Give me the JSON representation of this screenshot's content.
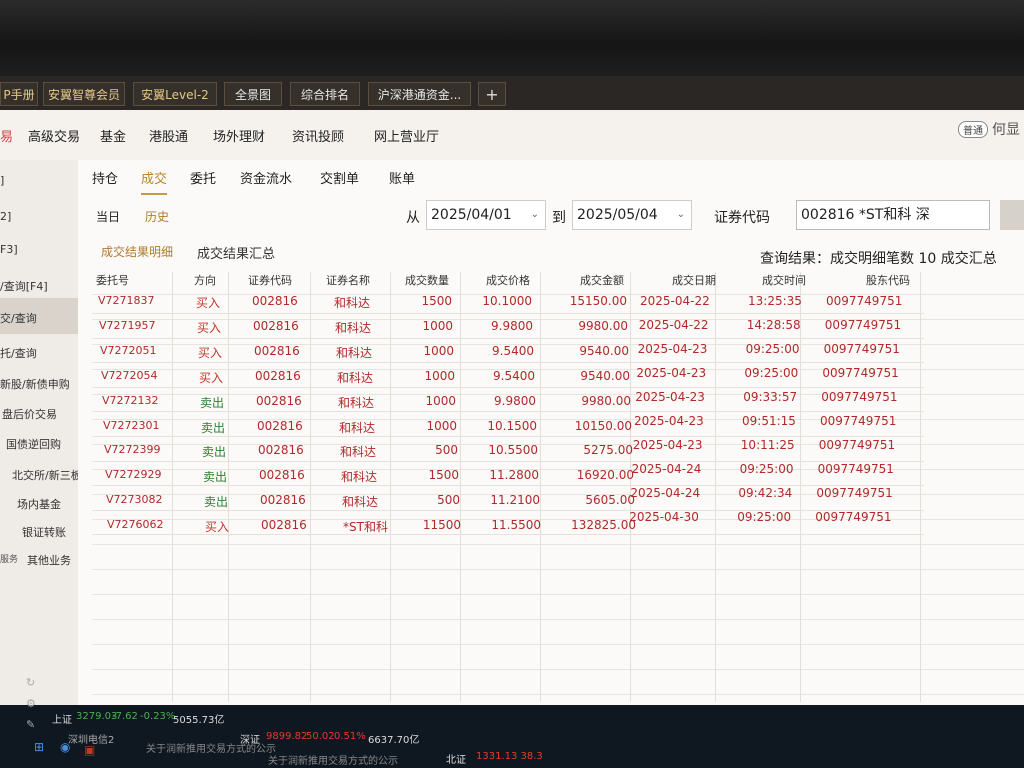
{
  "tabs": [
    {
      "label": "P手册"
    },
    {
      "label": "安翼智尊会员"
    },
    {
      "label": "安翼Level-2"
    },
    {
      "label": "全景图"
    },
    {
      "label": "综合排名"
    },
    {
      "label": "沪深港通资金..."
    },
    {
      "label": "+"
    }
  ],
  "menu": [
    {
      "label": "易"
    },
    {
      "label": "高级交易"
    },
    {
      "label": "基金"
    },
    {
      "label": "港股通"
    },
    {
      "label": "场外理财"
    },
    {
      "label": "资讯投顾"
    },
    {
      "label": "网上营业厅"
    }
  ],
  "header": {
    "badge": "普通",
    "user": "何显"
  },
  "sidebar": {
    "items": [
      {
        "label": "]"
      },
      {
        "label": "2]"
      },
      {
        "label": "F3]"
      },
      {
        "label": "/查询[F4]"
      },
      {
        "label": "交/查询"
      },
      {
        "label": "托/查询"
      },
      {
        "label": "新股/新债申购"
      },
      {
        "label": "盘后价交易"
      },
      {
        "label": "国债逆回购"
      },
      {
        "label": "北交所/新三板"
      },
      {
        "label": "场内基金"
      },
      {
        "label": "银证转账"
      },
      {
        "label": "其他业务"
      }
    ],
    "extra": "服务"
  },
  "subtabs": [
    {
      "label": "持仓"
    },
    {
      "label": "成交"
    },
    {
      "label": "委托"
    },
    {
      "label": "资金流水"
    },
    {
      "label": "交割单"
    },
    {
      "label": "账单"
    }
  ],
  "filter": {
    "today": "当日",
    "history": "历史",
    "from_label": "从",
    "from_date": "2025/04/01",
    "to_label": "到",
    "to_date": "2025/05/04",
    "code_label": "证券代码",
    "code_value": "002816 *ST和科 深"
  },
  "result_tabs": [
    {
      "label": "成交结果明细"
    },
    {
      "label": "成交结果汇总"
    }
  ],
  "summary": "查询结果：成交明细笔数 10  成交汇总",
  "table": {
    "headers": [
      "委托号",
      "方向",
      "证券代码",
      "证券名称",
      "成交数量",
      "成交价格",
      "成交金额",
      "成交日期",
      "成交时间",
      "股东代码"
    ],
    "rows": [
      {
        "order": "V7271837",
        "dir": "买入",
        "code": "002816",
        "name": "和科达",
        "qty": "1500",
        "price": "10.1000",
        "amount": "15150.00",
        "date": "2025-04-22",
        "time": "13:25:35",
        "holder": "0097749751"
      },
      {
        "order": "V7271957",
        "dir": "买入",
        "code": "002816",
        "name": "和科达",
        "qty": "1000",
        "price": "9.9800",
        "amount": "9980.00",
        "date": "2025-04-22",
        "time": "14:28:58",
        "holder": "0097749751"
      },
      {
        "order": "V7272051",
        "dir": "买入",
        "code": "002816",
        "name": "和科达",
        "qty": "1000",
        "price": "9.5400",
        "amount": "9540.00",
        "date": "2025-04-23",
        "time": "09:25:00",
        "holder": "0097749751"
      },
      {
        "order": "V7272054",
        "dir": "买入",
        "code": "002816",
        "name": "和科达",
        "qty": "1000",
        "price": "9.5400",
        "amount": "9540.00",
        "date": "2025-04-23",
        "time": "09:25:00",
        "holder": "0097749751"
      },
      {
        "order": "V7272132",
        "dir": "卖出",
        "code": "002816",
        "name": "和科达",
        "qty": "1000",
        "price": "9.9800",
        "amount": "9980.00",
        "date": "2025-04-23",
        "time": "09:33:57",
        "holder": "0097749751"
      },
      {
        "order": "V7272301",
        "dir": "卖出",
        "code": "002816",
        "name": "和科达",
        "qty": "1000",
        "price": "10.1500",
        "amount": "10150.00",
        "date": "2025-04-23",
        "time": "09:51:15",
        "holder": "0097749751"
      },
      {
        "order": "V7272399",
        "dir": "卖出",
        "code": "002816",
        "name": "和科达",
        "qty": "500",
        "price": "10.5500",
        "amount": "5275.00",
        "date": "2025-04-23",
        "time": "10:11:25",
        "holder": "0097749751"
      },
      {
        "order": "V7272929",
        "dir": "卖出",
        "code": "002816",
        "name": "和科达",
        "qty": "1500",
        "price": "11.2800",
        "amount": "16920.00",
        "date": "2025-04-24",
        "time": "09:25:00",
        "holder": "0097749751"
      },
      {
        "order": "V7273082",
        "dir": "卖出",
        "code": "002816",
        "name": "和科达",
        "qty": "500",
        "price": "11.2100",
        "amount": "5605.00",
        "date": "2025-04-24",
        "time": "09:42:34",
        "holder": "0097749751"
      },
      {
        "order": "V7276062",
        "dir": "买入",
        "code": "002816",
        "name": "*ST和科",
        "qty": "11500",
        "price": "11.5500",
        "amount": "132825.00",
        "date": "2025-04-30",
        "time": "09:25:00",
        "holder": "0097749751"
      }
    ]
  },
  "status": {
    "sh_label": "上证",
    "sh_value": "3279.03",
    "sh_change": "-7.62",
    "sh_pct": "-0.23%",
    "sh_volume": "5055.73亿",
    "sz_label": "深证",
    "sz_value": "9899.82",
    "sz_change": "50.02",
    "sz_pct": "0.51%",
    "sz_volume": "6637.70亿",
    "bz_label": "北证",
    "bz_value": "1331.13 38.3",
    "network": "深圳电信2",
    "notice1": "关于润新推用交易方式的公示",
    "notice2": "关于润新推用交易方式的公示"
  },
  "colors": {
    "buy": "#c0392b",
    "sell": "#2e7d32",
    "accent": "#c89a3f"
  }
}
